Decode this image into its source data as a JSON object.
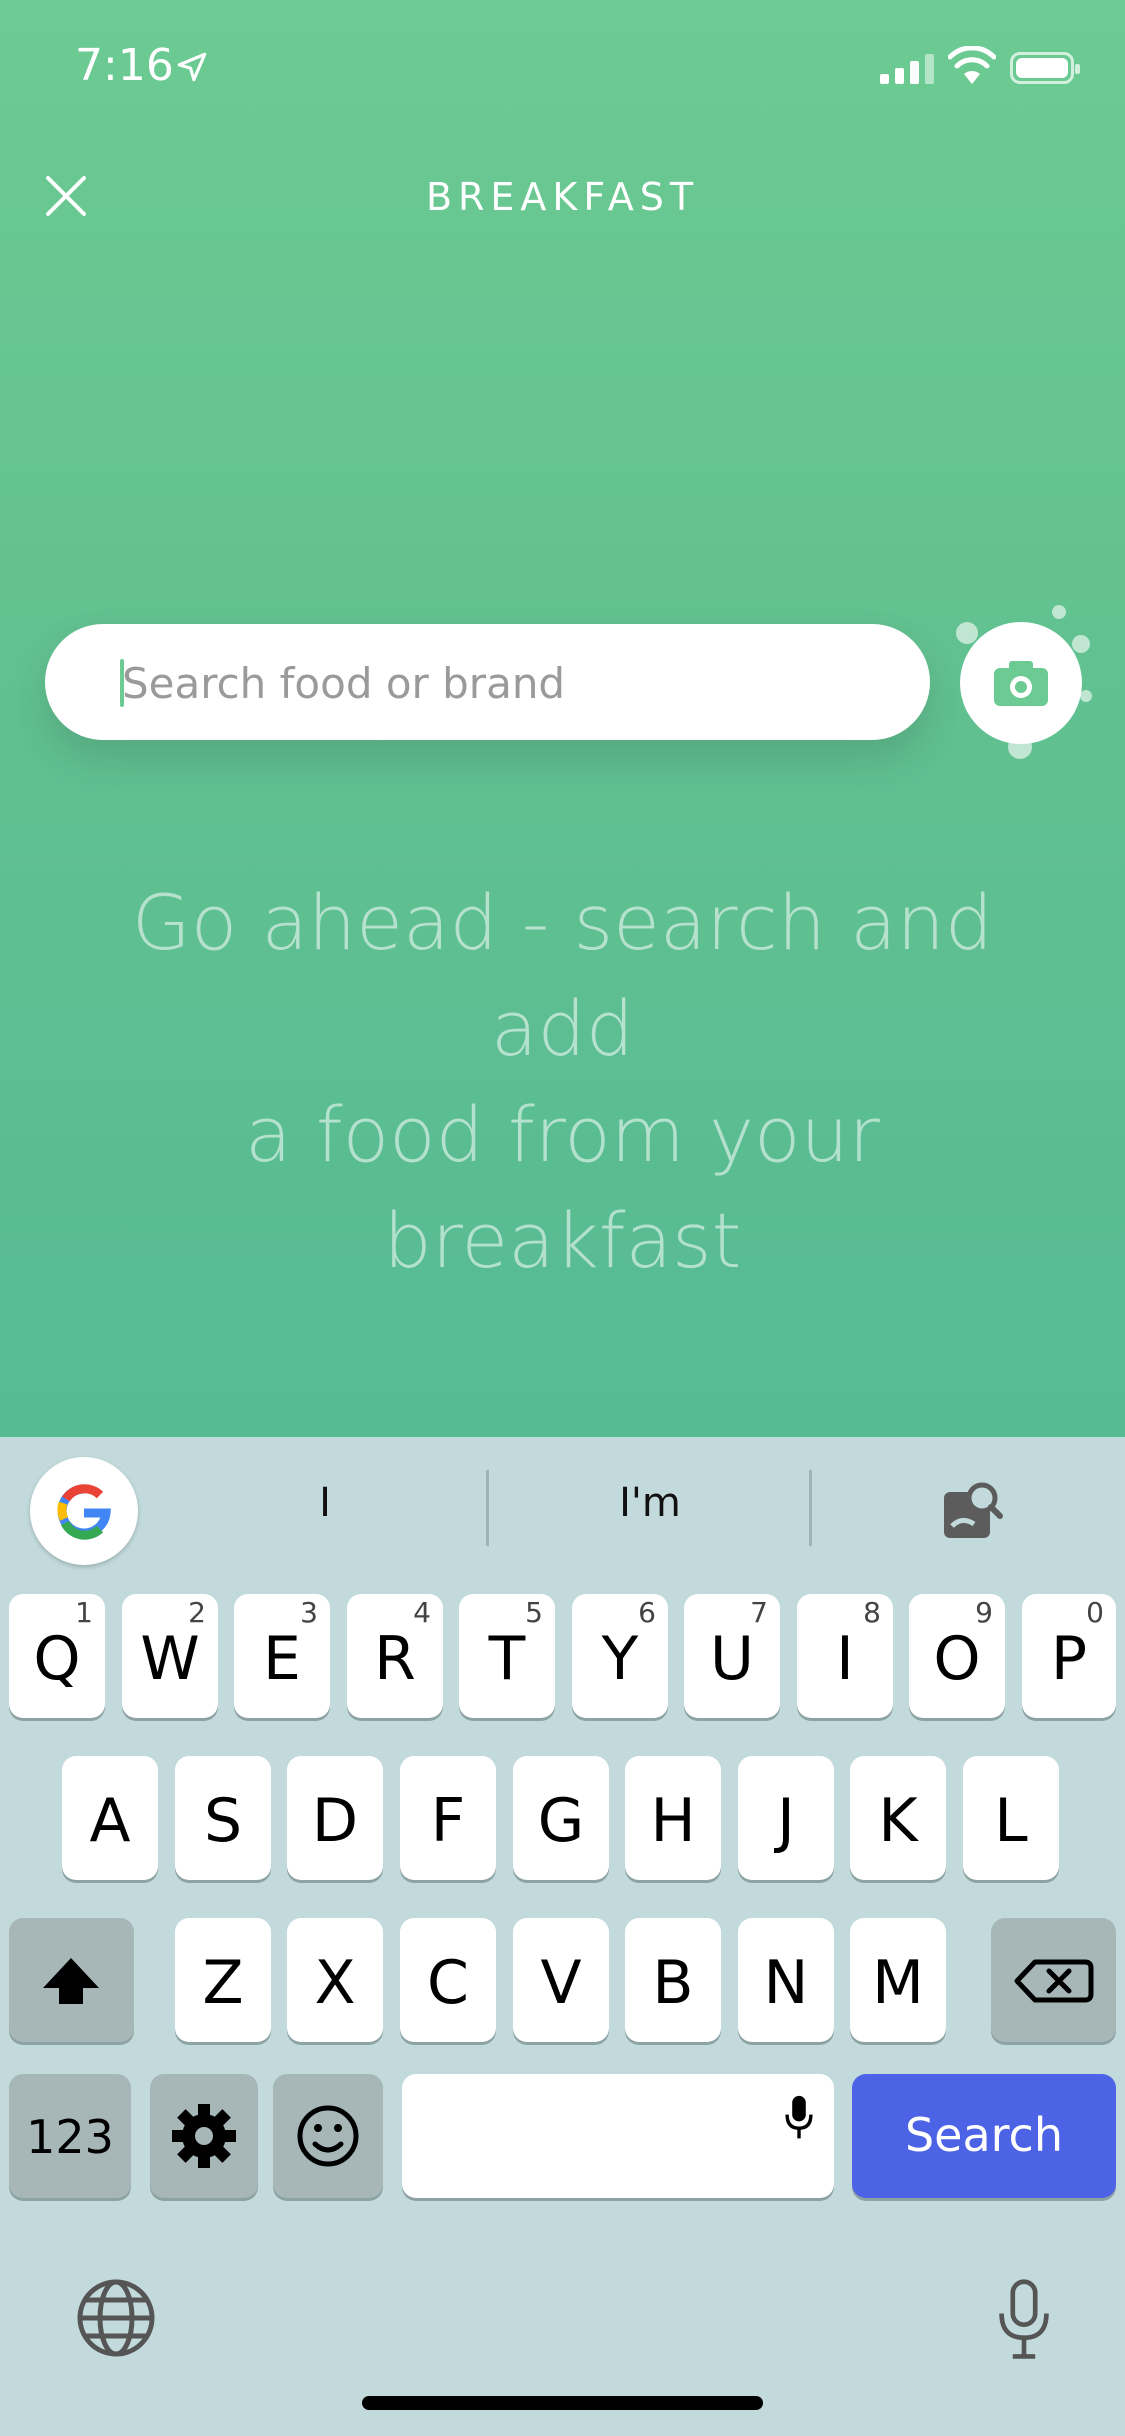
{
  "status": {
    "time": "7:16"
  },
  "header": {
    "title": "BREAKFAST"
  },
  "search": {
    "placeholder": "Search food or brand",
    "value": ""
  },
  "empty_state": {
    "line1": "Go ahead - search and add",
    "line2": "a food from your breakfast"
  },
  "keyboard": {
    "suggestions": [
      "I",
      "I'm"
    ],
    "row1": [
      {
        "key": "Q",
        "num": "1"
      },
      {
        "key": "W",
        "num": "2"
      },
      {
        "key": "E",
        "num": "3"
      },
      {
        "key": "R",
        "num": "4"
      },
      {
        "key": "T",
        "num": "5"
      },
      {
        "key": "Y",
        "num": "6"
      },
      {
        "key": "U",
        "num": "7"
      },
      {
        "key": "I",
        "num": "8"
      },
      {
        "key": "O",
        "num": "9"
      },
      {
        "key": "P",
        "num": "0"
      }
    ],
    "row2": [
      "A",
      "S",
      "D",
      "F",
      "G",
      "H",
      "J",
      "K",
      "L"
    ],
    "row3": [
      "Z",
      "X",
      "C",
      "V",
      "B",
      "N",
      "M"
    ],
    "numbers_key": "123",
    "search_key": "Search"
  },
  "colors": {
    "accent": "#6ccb92",
    "search_key": "#4c63e6"
  },
  "icons": [
    "location-arrow-icon",
    "close-icon",
    "camera-icon",
    "google-icon",
    "visual-search-icon",
    "shift-icon",
    "backspace-icon",
    "gear-icon",
    "emoji-icon",
    "mic-icon",
    "globe-icon",
    "dictation-icon"
  ]
}
